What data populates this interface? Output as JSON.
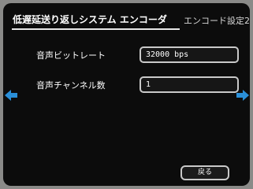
{
  "header": {
    "title": "低遅延送り返しシステム エンコーダ",
    "screen_label": "エンコード設定2"
  },
  "settings": [
    {
      "label": "音声ビットレート",
      "value": "32000 bps"
    },
    {
      "label": "音声チャンネル数",
      "value": "1"
    }
  ],
  "nav": {
    "prev_icon": "arrow-left-icon",
    "next_icon": "arrow-right-icon",
    "arrow_color": "#2a8fd8"
  },
  "footer": {
    "back_label": "戻る"
  }
}
